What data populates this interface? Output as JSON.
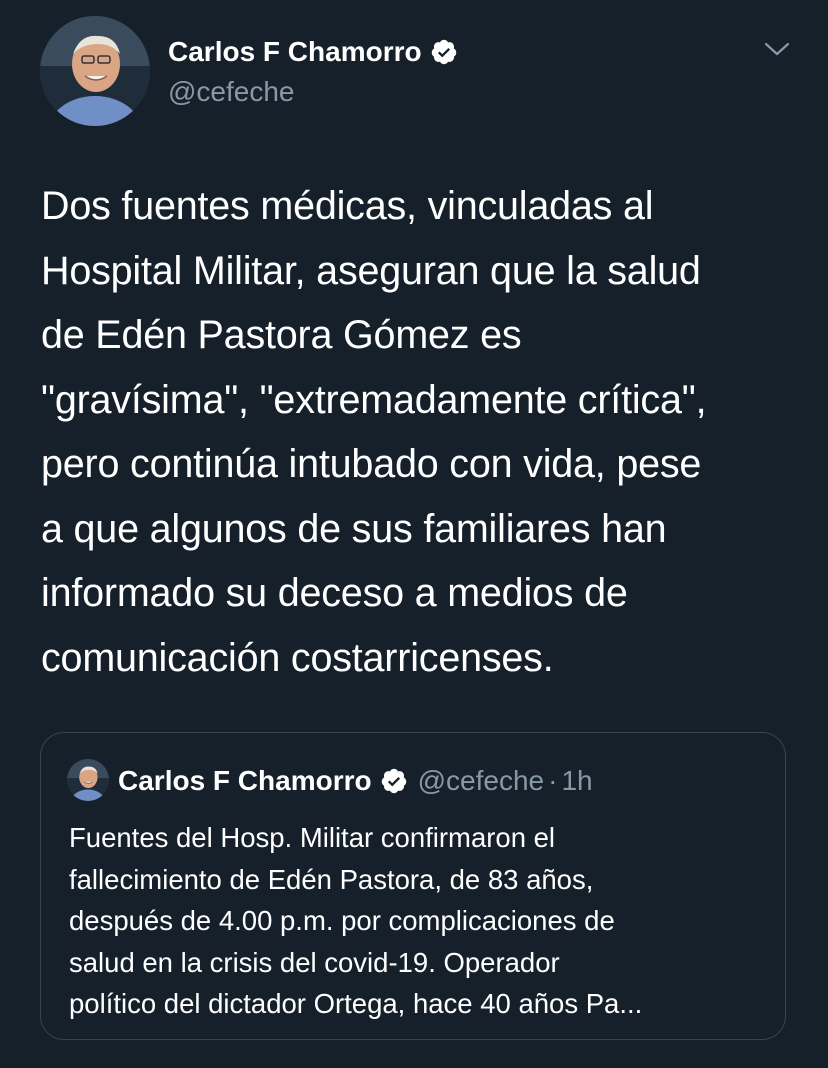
{
  "tweet": {
    "author": {
      "name": "Carlos F Chamorro",
      "handle": "@cefeche",
      "verified": true,
      "avatar_icon": "profile-photo"
    },
    "menu_icon": "chevron-down-icon",
    "text_lines": [
      "Dos fuentes médicas, vinculadas al",
      "Hospital Militar, aseguran que la salud",
      "de Edén Pastora Gómez es",
      "\"gravísima\", \"extremadamente crítica\",",
      "pero continúa intubado con vida, pese",
      "a que algunos de sus familiares han",
      "informado su deceso a medios de",
      "comunicación costarricenses."
    ]
  },
  "quoted_tweet": {
    "author": {
      "name": "Carlos F Chamorro",
      "handle": "@cefeche",
      "verified": true
    },
    "separator": "·",
    "time": "1h",
    "text_lines": [
      "Fuentes del Hosp. Militar confirmaron el",
      "fallecimiento de Edén Pastora, de 83 años,",
      "después de 4.00 p.m. por complicaciones de",
      "salud en la crisis del covid-19. Operador",
      "político del dictador Ortega, hace 40 años Pa..."
    ]
  },
  "colors": {
    "background": "#15202b",
    "text": "#ffffff",
    "secondary_text": "#8899a6",
    "border": "#38444d",
    "verified_badge": "#ffffff"
  }
}
